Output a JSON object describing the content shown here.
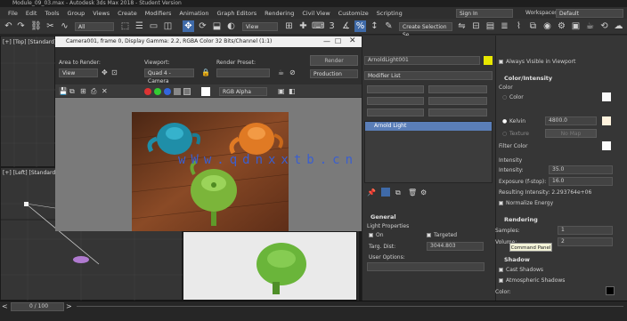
{
  "app": {
    "title": "Module_09_03.max - Autodesk 3ds Max 2018 - Student Version"
  },
  "menu": [
    "File",
    "Edit",
    "Tools",
    "Group",
    "Views",
    "Create",
    "Modifiers",
    "Animation",
    "Graph Editors",
    "Rendering",
    "Civil View",
    "Customize",
    "Scripting"
  ],
  "header": {
    "signin": "Sign In",
    "workspaces_label": "Workspaces:",
    "workspace_value": "Default",
    "all": "All",
    "view": "View",
    "selection_set": "Create Selection Se"
  },
  "viewports": {
    "top_label": "[+] [Top] [Standard]",
    "left_label": "[+] [Left] [Standard]"
  },
  "render_window": {
    "title": "Camera001, frame 0, Display Gamma: 2.2, RGBA Color 32 Bits/Channel (1:1)",
    "area_label": "Area to Render:",
    "area_value": "View",
    "viewport_label": "Viewport:",
    "viewport_value": "Quad 4 - Camera",
    "preset_label": "Render Preset:",
    "render_button": "Render",
    "production": "Production",
    "channel": "RGB Alpha"
  },
  "watermark": "wWw.qdnxxtb.cn",
  "modifier_panel": {
    "object_name": "ArnoldLight001",
    "modifier_list": "Modifier List",
    "stack_item": "Arnold Light"
  },
  "general": {
    "title": "General",
    "light_props": "Light Properties",
    "on": "On",
    "targeted": "Targeted",
    "targ_dist_label": "Targ. Dist:",
    "targ_dist_value": "3044.803",
    "user_options": "User Options:"
  },
  "right_panel": {
    "always_visible": "Always Visible in Viewport",
    "color_intensity": "Color/Intensity",
    "color_label": "Color",
    "color_opt": "Color",
    "kelvin_opt": "Kelvin",
    "kelvin_value": "4800.0",
    "texture_opt": "Texture",
    "texture_btn": "No Map",
    "filter_color": "Filter Color",
    "intensity_title": "Intensity",
    "intensity_label": "Intensity:",
    "intensity_value": "35.0",
    "exposure_label": "Exposure (f-stop):",
    "exposure_value": "16.0",
    "resulting_label": "Resulting Intensity: 2.293764e+06",
    "normalize": "Normalize Energy",
    "rendering_title": "Rendering",
    "samples_label": "Samples:",
    "samples_value": "1",
    "volume_label": "Volume:",
    "volume_value": "2",
    "tooltip": "Command Panel",
    "shadow_title": "Shadow",
    "cast_shadows": "Cast Shadows",
    "atmospheric": "Atmospheric Shadows",
    "shadow_color": "Color:"
  },
  "status": {
    "frame_counter": "0 / 100"
  },
  "colors": {
    "teapot_blue": "#1f8ea8",
    "teapot_orange": "#e07a24",
    "teapot_green": "#7bb53a",
    "floor": "#7a3e20",
    "accent": "#3f6aa8"
  }
}
